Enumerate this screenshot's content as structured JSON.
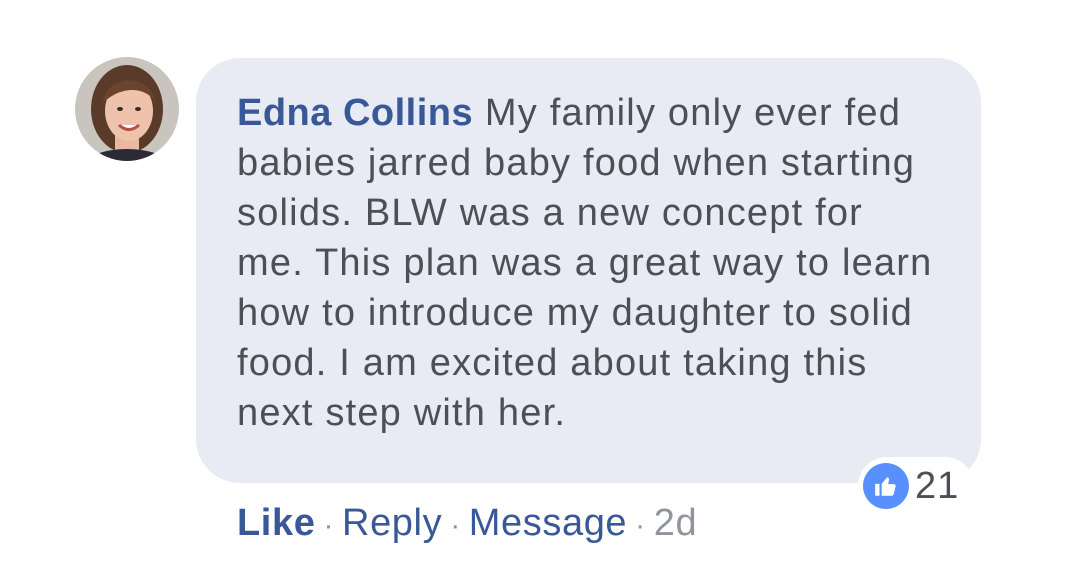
{
  "comment": {
    "author": "Edna Collins",
    "text": "My family only ever fed babies jarred baby food when starting solids. BLW was a new concept for me. This plan was a great way to learn how to introduce my daughter to solid food. I am excited about taking this next step with her.",
    "reactions": {
      "icon": "thumbs-up-icon",
      "count": "21",
      "color": "#5890ff"
    }
  },
  "actions": {
    "like": "Like",
    "reply": "Reply",
    "message": "Message",
    "separator": "·",
    "timestamp": "2d"
  },
  "colors": {
    "author": "#385898",
    "bubble": "#e9ebf4",
    "text": "#4b4f56",
    "meta": "#90949c"
  }
}
